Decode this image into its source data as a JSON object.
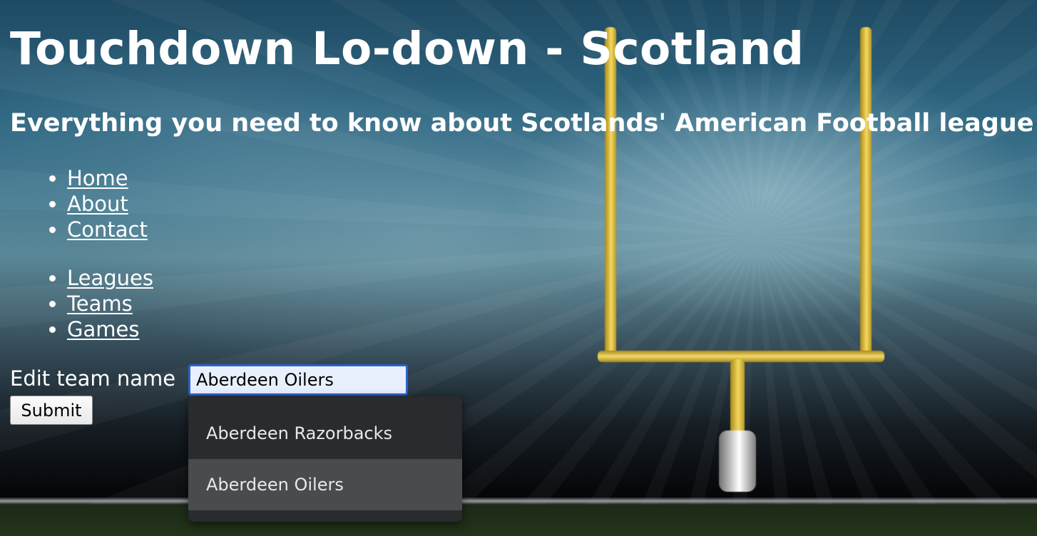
{
  "header": {
    "title": "Touchdown Lo-down - Scotland",
    "subtitle": "Everything you need to know about Scotlands' American Football league"
  },
  "nav_main": [
    {
      "label": "Home"
    },
    {
      "label": "About"
    },
    {
      "label": "Contact"
    }
  ],
  "nav_data": [
    {
      "label": "Leagues"
    },
    {
      "label": "Teams"
    },
    {
      "label": "Games"
    }
  ],
  "form": {
    "label": "Edit team name",
    "input_value": "Aberdeen Oilers",
    "submit_label": "Submit"
  },
  "autocomplete": {
    "options": [
      {
        "label": "Aberdeen Razorbacks",
        "highlighted": false
      },
      {
        "label": "Aberdeen Oilers",
        "highlighted": true
      }
    ]
  },
  "colors": {
    "post": "#e8c94a",
    "input_focus_border": "#2a62c9",
    "input_autofill_bg": "#e8f0fe",
    "dropdown_bg": "#2a2b2e",
    "dropdown_highlight": "#4a4b4f"
  }
}
